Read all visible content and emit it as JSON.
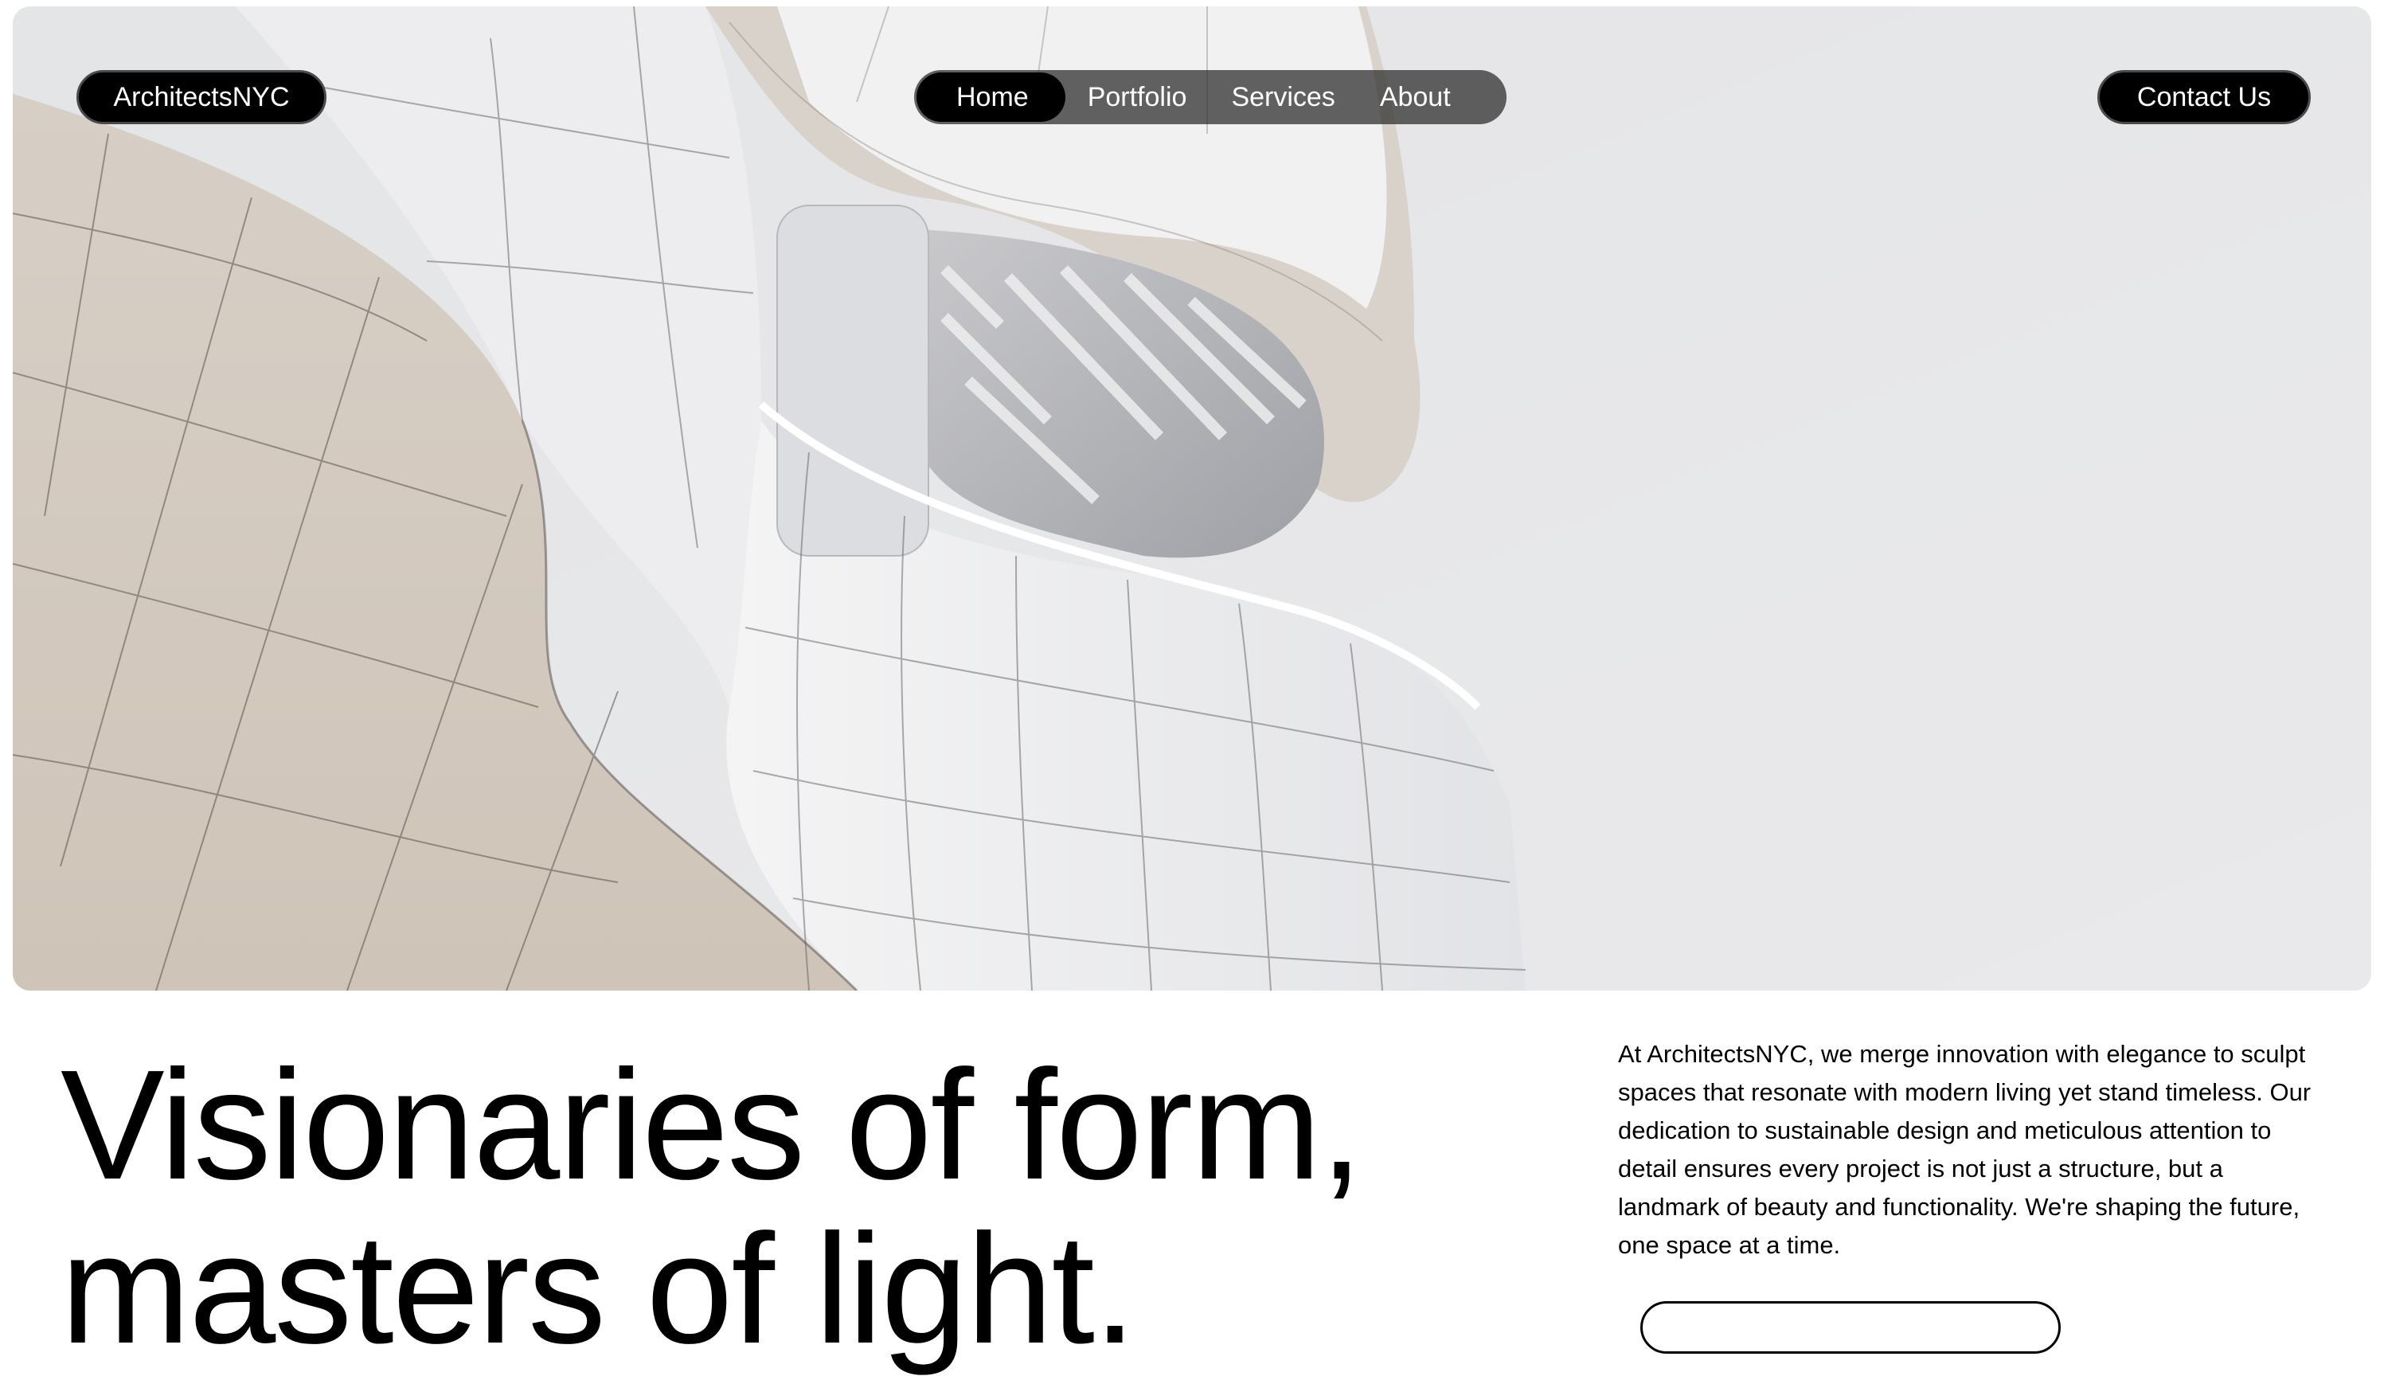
{
  "colors": {
    "accent": "#000000",
    "nav_background": "#3c3c3c",
    "hero_background": "#e6e7e9",
    "facade_white": "#f0f0f2",
    "facade_beige": "#d6ccc2"
  },
  "header": {
    "brand_label": "ArchitectsNYC",
    "nav": [
      {
        "label": "Home",
        "active": true
      },
      {
        "label": "Portfolio",
        "active": false
      },
      {
        "label": "Services",
        "active": false
      },
      {
        "label": "About",
        "active": false
      }
    ],
    "contact_label": "Contact Us"
  },
  "hero": {
    "image_subject": "curved white architectural facade"
  },
  "main": {
    "headline": "Visionaries of form,\nmasters of light.",
    "intro": "At ArchitectsNYC, we merge innovation with elegance to sculpt spaces that resonate with modern living yet stand timeless. Our dedication to sustainable design and meticulous attention to detail ensures every project is not just a structure, but a landmark of beauty and functionality. We're shaping the future, one space at a time."
  }
}
